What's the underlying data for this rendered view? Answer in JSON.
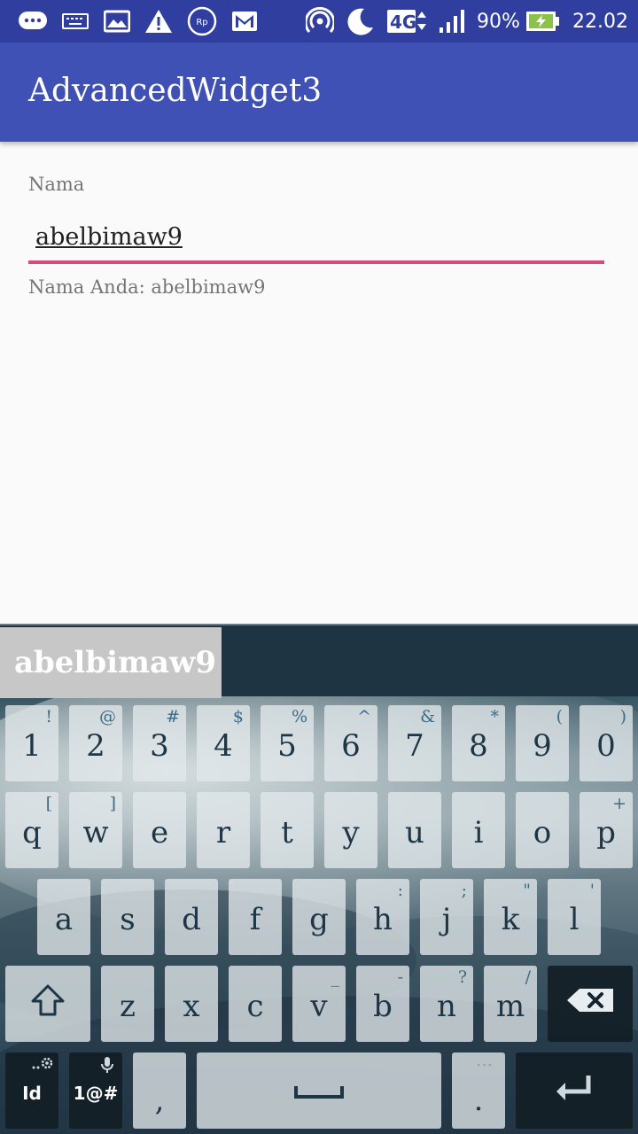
{
  "status_bar": {
    "battery": "90%",
    "network": "4G",
    "time": "22.02",
    "icons": [
      "message-icon",
      "keyboard-icon",
      "image-icon",
      "warning-icon",
      "rupiah-icon",
      "gmail-icon",
      "hotspot-icon",
      "moon-icon",
      "network-4g-icon",
      "signal-icon",
      "battery-charging-icon"
    ]
  },
  "app_bar": {
    "title": "AdvancedWidget3"
  },
  "form": {
    "label": "Nama",
    "input_value": "abelbimaw9",
    "result": "Nama Anda: abelbimaw9"
  },
  "keyboard": {
    "suggestion": "abelbimaw9",
    "row1": [
      {
        "main": "1",
        "sub": "!"
      },
      {
        "main": "2",
        "sub": "@"
      },
      {
        "main": "3",
        "sub": "#"
      },
      {
        "main": "4",
        "sub": "$"
      },
      {
        "main": "5",
        "sub": "%"
      },
      {
        "main": "6",
        "sub": "^"
      },
      {
        "main": "7",
        "sub": "&"
      },
      {
        "main": "8",
        "sub": "*"
      },
      {
        "main": "9",
        "sub": "("
      },
      {
        "main": "0",
        "sub": ")"
      }
    ],
    "row2": [
      {
        "main": "q",
        "sub": "["
      },
      {
        "main": "w",
        "sub": "]"
      },
      {
        "main": "e",
        "sub": ""
      },
      {
        "main": "r",
        "sub": ""
      },
      {
        "main": "t",
        "sub": ""
      },
      {
        "main": "y",
        "sub": ""
      },
      {
        "main": "u",
        "sub": ""
      },
      {
        "main": "i",
        "sub": ""
      },
      {
        "main": "o",
        "sub": ""
      },
      {
        "main": "p",
        "sub": "+"
      }
    ],
    "row3": [
      {
        "main": "a",
        "sub": ""
      },
      {
        "main": "s",
        "sub": ""
      },
      {
        "main": "d",
        "sub": ""
      },
      {
        "main": "f",
        "sub": ""
      },
      {
        "main": "g",
        "sub": ""
      },
      {
        "main": "h",
        "sub": ":"
      },
      {
        "main": "j",
        "sub": ";"
      },
      {
        "main": "k",
        "sub": "\""
      },
      {
        "main": "l",
        "sub": "'"
      }
    ],
    "row4": [
      {
        "main": "z",
        "sub": ""
      },
      {
        "main": "x",
        "sub": ""
      },
      {
        "main": "c",
        "sub": ""
      },
      {
        "main": "v",
        "sub": "_"
      },
      {
        "main": "b",
        "sub": "-"
      },
      {
        "main": "n",
        "sub": "?"
      },
      {
        "main": "m",
        "sub": "/"
      }
    ],
    "lang_key": "Id",
    "symbols_key": "1@#",
    "comma_key": ",",
    "period_key": "."
  }
}
